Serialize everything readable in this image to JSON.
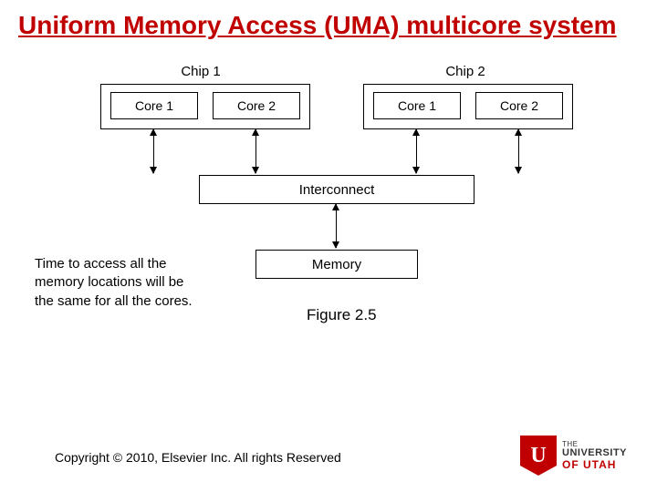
{
  "title": "Uniform Memory Access (UMA) multicore system",
  "diagram": {
    "chips": [
      {
        "label": "Chip 1",
        "cores": [
          "Core 1",
          "Core 2"
        ]
      },
      {
        "label": "Chip 2",
        "cores": [
          "Core 1",
          "Core 2"
        ]
      }
    ],
    "interconnect": "Interconnect",
    "memory": "Memory"
  },
  "caption": "Time to access all the memory locations will be the same for all the cores.",
  "figure_label": "Figure 2.5",
  "copyright": "Copyright © 2010, Elsevier Inc. All rights Reserved",
  "logo": {
    "line1": "THE",
    "line2": "UNIVERSITY",
    "line3": "OF UTAH",
    "letter": "U"
  }
}
